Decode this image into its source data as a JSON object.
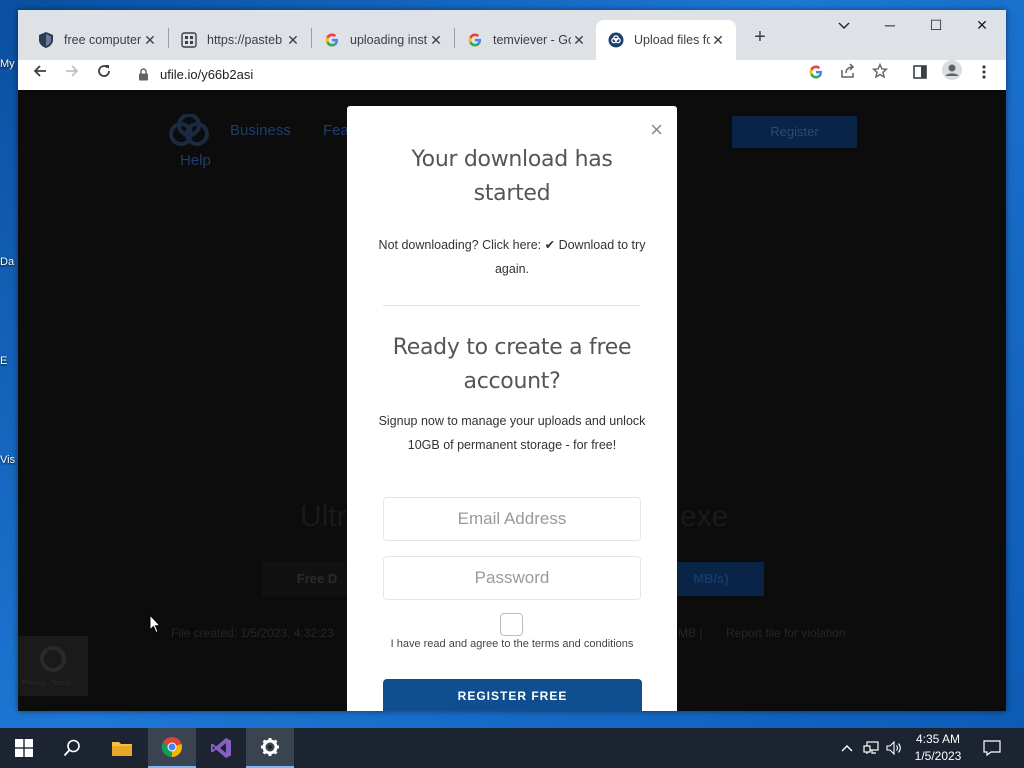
{
  "desktop": {
    "icon_labels": [
      "My",
      "Da",
      "E",
      "Vis"
    ]
  },
  "browser": {
    "tabs": [
      {
        "title": "free computer",
        "favicon": "shield-icon"
      },
      {
        "title": "https://pasteb",
        "favicon": "pastebin-icon"
      },
      {
        "title": "uploading inst",
        "favicon": "google-icon"
      },
      {
        "title": "temviever - Go",
        "favicon": "google-icon"
      },
      {
        "title": "Upload files fo",
        "favicon": "ufile-icon",
        "active": true
      }
    ],
    "url": "ufile.io/y66b2asi"
  },
  "page_bg": {
    "nav_business": "Business",
    "nav_fe": "Fea",
    "nav_help": "Help",
    "register": "Register",
    "hero_left": "Ultr",
    "hero_right": "exe",
    "free_btn": "Free D",
    "speed_btn": "MB/s)",
    "file_created": "File created: 1/5/2023, 4:32:23",
    "size_sep": "MB   |",
    "report": "Report file for violation",
    "recaptcha": "Privacy - Terms"
  },
  "modal": {
    "close_label": "×",
    "download_title": "Your download has started",
    "not_downloading": "Not downloading? Click here:",
    "download_link": "✔ Download",
    "try_again": "to try again.",
    "account_title": "Ready to create a free account?",
    "signup_text": "Signup now to manage your uploads and unlock 10GB of permanent storage - for free!",
    "email_placeholder": "Email Address",
    "password_placeholder": "Password",
    "terms_text": "I have read and agree to the terms and conditions",
    "register_button": "REGISTER FREE"
  },
  "taskbar": {
    "time": "4:35 AM",
    "date": "1/5/2023"
  },
  "colors": {
    "modal_button": "#0f4f8f",
    "taskbar": "#1b2430"
  }
}
